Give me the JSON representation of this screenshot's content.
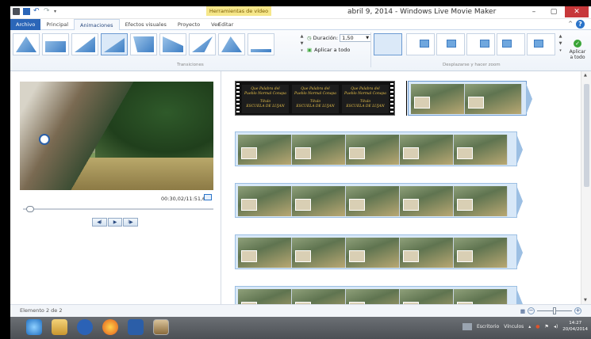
{
  "titlebar": {
    "title": "abril 9, 2014 - Windows Live Movie Maker",
    "context_group": "Herramientas de vídeo",
    "minimize": "–",
    "maximize": "▢",
    "close": "✕"
  },
  "tabs": {
    "file": "Archivo",
    "items": [
      "Principal",
      "Animaciones",
      "Efectos visuales",
      "Proyecto",
      "Ver"
    ],
    "context_tab": "Editar",
    "help": "?"
  },
  "ribbon": {
    "duration_label": "Duración:",
    "duration_value": "1,50",
    "apply_all": "Aplicar a todo",
    "group_transitions": "Transiciones",
    "group_pan_zoom": "Desplazarse y hacer zoom",
    "apply_all_pan": "Aplicar a todo"
  },
  "preview": {
    "time": "00:30,02/11:51,64"
  },
  "playback": {
    "prev": "◀I",
    "play": "▶",
    "next": "I▶"
  },
  "title_clip": {
    "line1": "Que Palabra del",
    "line2": "Pueblo Normal Conapa",
    "line3": "Título",
    "line4": "ESCUELA DE LUJAN"
  },
  "status": {
    "label": "Elemento 2 de 2",
    "zoom_out": "−",
    "zoom_in": "+"
  },
  "taskbar": {
    "desktop": "Escritorio",
    "links": "Vínculos",
    "time": "14:27",
    "date": "20/04/2014"
  },
  "colors": {
    "file_tab": "#2b66b8",
    "context_group": "#f6e78a",
    "close": "#c7383a",
    "story_row": "#d8e8f8"
  }
}
